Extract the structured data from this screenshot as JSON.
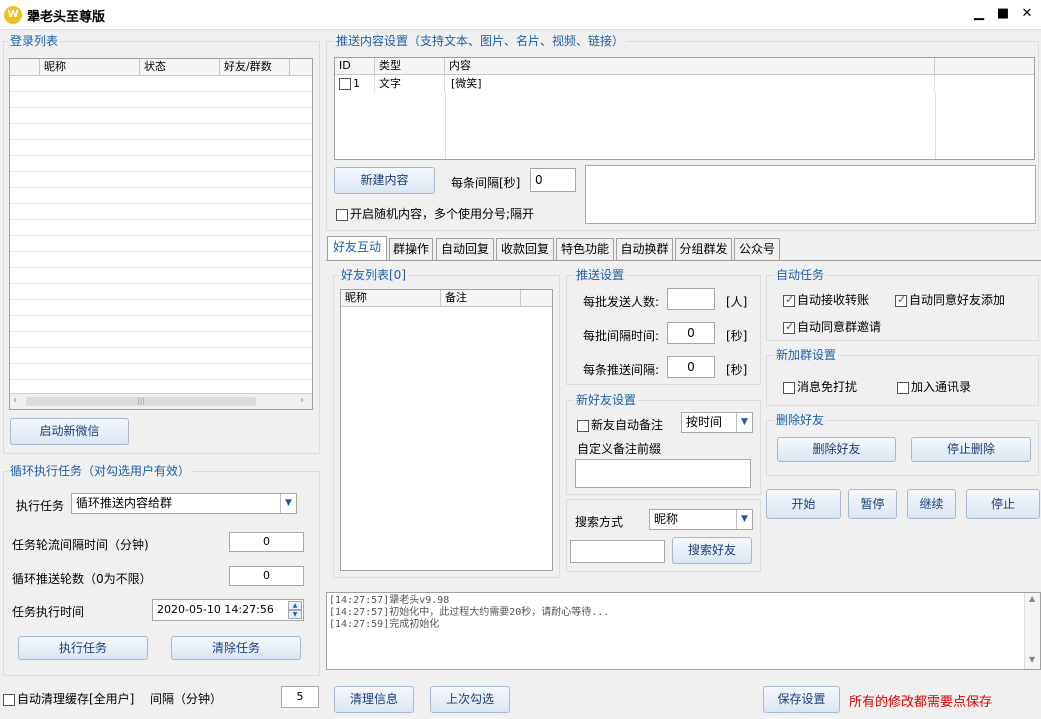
{
  "window": {
    "title": "犟老头至尊版",
    "min": "▁",
    "max": "■",
    "close": "✕",
    "icon_text": "W"
  },
  "login_list": {
    "label": "登录列表",
    "columns": [
      "昵称",
      "状态",
      "好友/群数"
    ],
    "scroll_mark": "|||",
    "start_button": "启动新微信"
  },
  "loop_task": {
    "label": "循环执行任务（对勾选用户有效）",
    "task_label": "执行任务",
    "task_value": "循环推送内容给群",
    "interval_label": "任务轮流间隔时间（分钟)",
    "interval_value": "0",
    "rounds_label": "循环推送轮数（0为不限）",
    "rounds_value": "0",
    "time_label": "任务执行时间",
    "time_value": "2020-05-10 14:27:56",
    "run_button": "执行任务",
    "clear_button": "清除任务"
  },
  "bottom_left": {
    "auto_clear_label": "自动清理缓存[全用户]",
    "interval_label": "间隔（分钟）",
    "interval_value": "5"
  },
  "push_content": {
    "label": "推送内容设置（支持文本、图片、名片、视频、链接）",
    "columns": [
      "ID",
      "类型",
      "内容"
    ],
    "rows": [
      {
        "id": "1",
        "type": "文字",
        "content": "[微笑]"
      }
    ],
    "new_button": "新建内容",
    "interval_label": "每条间隔[秒]",
    "interval_value": "0",
    "random_label": "开启随机内容，多个使用分号;隔开"
  },
  "tabs": [
    "好友互动",
    "群操作",
    "自动回复",
    "收款回复",
    "特色功能",
    "自动换群",
    "分组群发",
    "公众号"
  ],
  "friend_list": {
    "label": "好友列表[0]",
    "columns": [
      "昵称",
      "备注"
    ]
  },
  "push_settings": {
    "label": "推送设置",
    "batch_count_label": "每批发送人数:",
    "batch_count_value": "",
    "batch_count_unit": "[人]",
    "batch_interval_label": "每批间隔时间:",
    "batch_interval_value": "0",
    "batch_interval_unit": "[秒]",
    "each_interval_label": "每条推送间隔:",
    "each_interval_value": "0",
    "each_interval_unit": "[秒]"
  },
  "new_friend": {
    "label": "新好友设置",
    "auto_note_label": "新友自动备注",
    "auto_note_mode": "按时间",
    "prefix_label": "自定义备注前缀",
    "prefix_value": ""
  },
  "search": {
    "mode_label": "搜索方式",
    "mode_value": "昵称",
    "input_value": "",
    "button": "搜索好友"
  },
  "auto_tasks": {
    "label": "自动任务",
    "accept_transfer": "自动接收转账",
    "accept_friend": "自动同意好友添加",
    "accept_group": "自动同意群邀请"
  },
  "new_group": {
    "label": "新加群设置",
    "mute": "消息免打扰",
    "add_contact": "加入通讯录"
  },
  "delete_friend": {
    "label": "删除好友",
    "delete_button": "删除好友",
    "stop_button": "停止删除"
  },
  "controls": {
    "start": "开始",
    "pause": "暂停",
    "resume": "继续",
    "stop": "停止"
  },
  "log": {
    "lines": [
      "[14:27:57]犟老头v9.98",
      "[14:27:57]初始化中，此过程大约需要20秒，请耐心等待...",
      "[14:27:59]完成初始化"
    ]
  },
  "footer": {
    "clear_info": "清理信息",
    "last_check": "上次勾选",
    "save_settings": "保存设置",
    "save_note": "所有的修改都需要点保存"
  },
  "colors": {
    "accent": "#1e5fa8",
    "warning": "#e00000"
  }
}
